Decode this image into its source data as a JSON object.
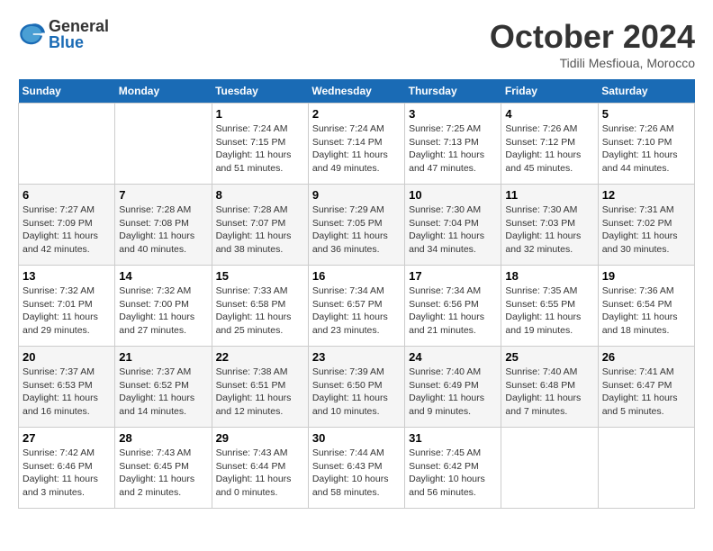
{
  "header": {
    "logo_general": "General",
    "logo_blue": "Blue",
    "month_title": "October 2024",
    "location": "Tidili Mesfioua, Morocco"
  },
  "days_of_week": [
    "Sunday",
    "Monday",
    "Tuesday",
    "Wednesday",
    "Thursday",
    "Friday",
    "Saturday"
  ],
  "weeks": [
    {
      "days": [
        {
          "num": "",
          "info": ""
        },
        {
          "num": "",
          "info": ""
        },
        {
          "num": "1",
          "info": "Sunrise: 7:24 AM\nSunset: 7:15 PM\nDaylight: 11 hours and 51 minutes."
        },
        {
          "num": "2",
          "info": "Sunrise: 7:24 AM\nSunset: 7:14 PM\nDaylight: 11 hours and 49 minutes."
        },
        {
          "num": "3",
          "info": "Sunrise: 7:25 AM\nSunset: 7:13 PM\nDaylight: 11 hours and 47 minutes."
        },
        {
          "num": "4",
          "info": "Sunrise: 7:26 AM\nSunset: 7:12 PM\nDaylight: 11 hours and 45 minutes."
        },
        {
          "num": "5",
          "info": "Sunrise: 7:26 AM\nSunset: 7:10 PM\nDaylight: 11 hours and 44 minutes."
        }
      ]
    },
    {
      "days": [
        {
          "num": "6",
          "info": "Sunrise: 7:27 AM\nSunset: 7:09 PM\nDaylight: 11 hours and 42 minutes."
        },
        {
          "num": "7",
          "info": "Sunrise: 7:28 AM\nSunset: 7:08 PM\nDaylight: 11 hours and 40 minutes."
        },
        {
          "num": "8",
          "info": "Sunrise: 7:28 AM\nSunset: 7:07 PM\nDaylight: 11 hours and 38 minutes."
        },
        {
          "num": "9",
          "info": "Sunrise: 7:29 AM\nSunset: 7:05 PM\nDaylight: 11 hours and 36 minutes."
        },
        {
          "num": "10",
          "info": "Sunrise: 7:30 AM\nSunset: 7:04 PM\nDaylight: 11 hours and 34 minutes."
        },
        {
          "num": "11",
          "info": "Sunrise: 7:30 AM\nSunset: 7:03 PM\nDaylight: 11 hours and 32 minutes."
        },
        {
          "num": "12",
          "info": "Sunrise: 7:31 AM\nSunset: 7:02 PM\nDaylight: 11 hours and 30 minutes."
        }
      ]
    },
    {
      "days": [
        {
          "num": "13",
          "info": "Sunrise: 7:32 AM\nSunset: 7:01 PM\nDaylight: 11 hours and 29 minutes."
        },
        {
          "num": "14",
          "info": "Sunrise: 7:32 AM\nSunset: 7:00 PM\nDaylight: 11 hours and 27 minutes."
        },
        {
          "num": "15",
          "info": "Sunrise: 7:33 AM\nSunset: 6:58 PM\nDaylight: 11 hours and 25 minutes."
        },
        {
          "num": "16",
          "info": "Sunrise: 7:34 AM\nSunset: 6:57 PM\nDaylight: 11 hours and 23 minutes."
        },
        {
          "num": "17",
          "info": "Sunrise: 7:34 AM\nSunset: 6:56 PM\nDaylight: 11 hours and 21 minutes."
        },
        {
          "num": "18",
          "info": "Sunrise: 7:35 AM\nSunset: 6:55 PM\nDaylight: 11 hours and 19 minutes."
        },
        {
          "num": "19",
          "info": "Sunrise: 7:36 AM\nSunset: 6:54 PM\nDaylight: 11 hours and 18 minutes."
        }
      ]
    },
    {
      "days": [
        {
          "num": "20",
          "info": "Sunrise: 7:37 AM\nSunset: 6:53 PM\nDaylight: 11 hours and 16 minutes."
        },
        {
          "num": "21",
          "info": "Sunrise: 7:37 AM\nSunset: 6:52 PM\nDaylight: 11 hours and 14 minutes."
        },
        {
          "num": "22",
          "info": "Sunrise: 7:38 AM\nSunset: 6:51 PM\nDaylight: 11 hours and 12 minutes."
        },
        {
          "num": "23",
          "info": "Sunrise: 7:39 AM\nSunset: 6:50 PM\nDaylight: 11 hours and 10 minutes."
        },
        {
          "num": "24",
          "info": "Sunrise: 7:40 AM\nSunset: 6:49 PM\nDaylight: 11 hours and 9 minutes."
        },
        {
          "num": "25",
          "info": "Sunrise: 7:40 AM\nSunset: 6:48 PM\nDaylight: 11 hours and 7 minutes."
        },
        {
          "num": "26",
          "info": "Sunrise: 7:41 AM\nSunset: 6:47 PM\nDaylight: 11 hours and 5 minutes."
        }
      ]
    },
    {
      "days": [
        {
          "num": "27",
          "info": "Sunrise: 7:42 AM\nSunset: 6:46 PM\nDaylight: 11 hours and 3 minutes."
        },
        {
          "num": "28",
          "info": "Sunrise: 7:43 AM\nSunset: 6:45 PM\nDaylight: 11 hours and 2 minutes."
        },
        {
          "num": "29",
          "info": "Sunrise: 7:43 AM\nSunset: 6:44 PM\nDaylight: 11 hours and 0 minutes."
        },
        {
          "num": "30",
          "info": "Sunrise: 7:44 AM\nSunset: 6:43 PM\nDaylight: 10 hours and 58 minutes."
        },
        {
          "num": "31",
          "info": "Sunrise: 7:45 AM\nSunset: 6:42 PM\nDaylight: 10 hours and 56 minutes."
        },
        {
          "num": "",
          "info": ""
        },
        {
          "num": "",
          "info": ""
        }
      ]
    }
  ]
}
